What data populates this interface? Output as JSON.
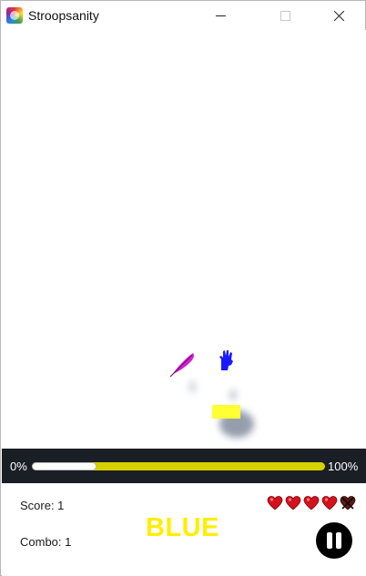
{
  "window": {
    "title": "Stroopsanity",
    "app_icon": "stroopsanity-app-icon",
    "minimize_icon": "minimize-icon",
    "maximize_icon": "maximize-icon",
    "close_icon": "close-icon"
  },
  "game": {
    "falling_objects": [
      {
        "name": "magenta-feather",
        "color": "#d21fd2"
      },
      {
        "name": "blue-glove",
        "color": "#1a1aff"
      },
      {
        "name": "yellow-block",
        "color": "#ffff33"
      }
    ]
  },
  "progress": {
    "left_label": "0%",
    "right_label": "100%",
    "value_fraction": 0.22,
    "track_color": "#d6d000",
    "fill_color": "#ffffff"
  },
  "hud": {
    "score_label": "Score: 1",
    "combo_label": "Combo: 1",
    "prompt_word": "BLUE",
    "prompt_color": "#ffee00",
    "lives_total": 5,
    "lives_remaining": 4,
    "heart_icon": "heart-icon",
    "lost_life_icon": "broken-heart-icon",
    "pause_icon": "pause-icon"
  }
}
